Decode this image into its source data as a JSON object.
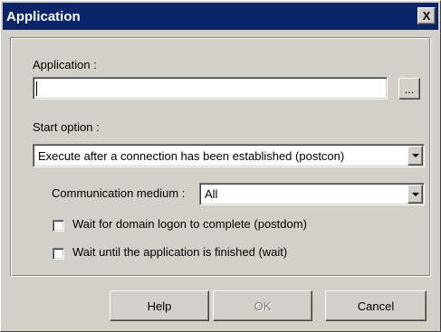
{
  "window": {
    "title": "Application",
    "close_label": "X"
  },
  "application": {
    "label": "Application :",
    "value": "",
    "browse_label": "..."
  },
  "start_option": {
    "label": "Start option :",
    "selected": "Execute after a connection has been established (postcon)"
  },
  "communication_medium": {
    "label": "Communication medium :",
    "selected": "All"
  },
  "checkboxes": {
    "wait_domain_logon": {
      "label": "Wait for domain logon to complete  (postdom)",
      "checked": false
    },
    "wait_app_finished": {
      "label": "Wait until the application is finished  (wait)",
      "checked": false
    }
  },
  "buttons": {
    "help_label": "Help",
    "ok_label": "OK",
    "ok_enabled": false,
    "cancel_label": "Cancel"
  },
  "colors": {
    "titlebar": "#0a246a",
    "face": "#d4d0c8"
  }
}
